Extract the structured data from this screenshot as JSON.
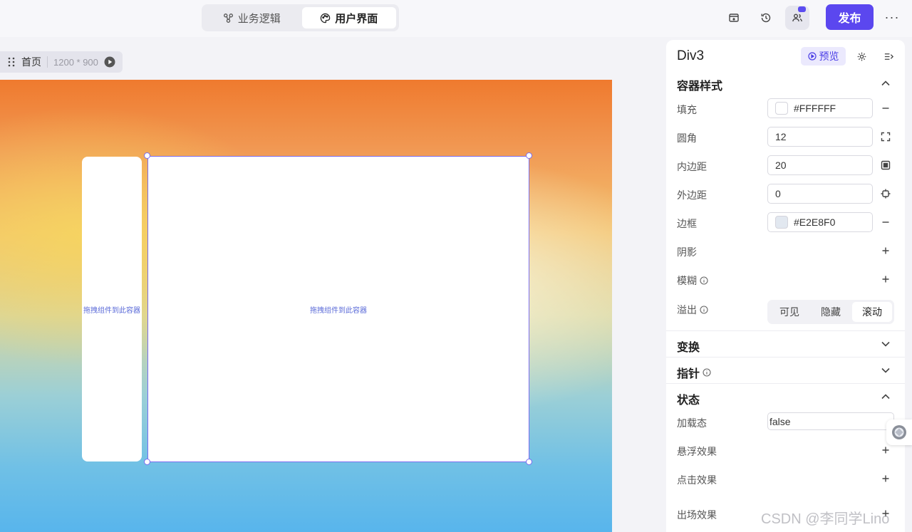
{
  "header": {
    "tabs": [
      {
        "label": "业务逻辑",
        "icon": "flow-nodes-icon"
      },
      {
        "label": "用户界面",
        "icon": "palette-icon"
      }
    ],
    "active_tab": 1,
    "publish_label": "发布",
    "more_label": "···"
  },
  "page": {
    "name": "首页",
    "size": "1200 * 900"
  },
  "canvas": {
    "side_container_hint": "拖拽组件到此容器",
    "main_container_hint": "拖拽组件到此容器"
  },
  "panel": {
    "component_name": "Div3",
    "preview_label": "预览",
    "container_style": {
      "title": "容器样式",
      "fill_label": "填充",
      "fill_value": "#FFFFFF",
      "radius_label": "圆角",
      "radius_value": "12",
      "padding_label": "内边距",
      "padding_value": "20",
      "margin_label": "外边距",
      "margin_value": "0",
      "border_label": "边框",
      "border_value": "#E2E8F0",
      "shadow_label": "阴影",
      "blur_label": "模糊",
      "overflow_label": "溢出",
      "overflow_options": [
        "可见",
        "隐藏",
        "滚动"
      ],
      "overflow_selected": "滚动"
    },
    "transform_title": "变换",
    "pointer_title": "指针",
    "state": {
      "title": "状态",
      "loading_label": "加载态",
      "loading_value": "false",
      "hover_label": "悬浮效果",
      "click_label": "点击效果",
      "enter_label": "出场效果"
    }
  },
  "colors": {
    "accent": "#5B47EF",
    "selection": "#7A6CF0",
    "fill_swatch": "#FFFFFF",
    "border_swatch": "#E2E8F0"
  },
  "watermark": "CSDN @李同学Lino"
}
